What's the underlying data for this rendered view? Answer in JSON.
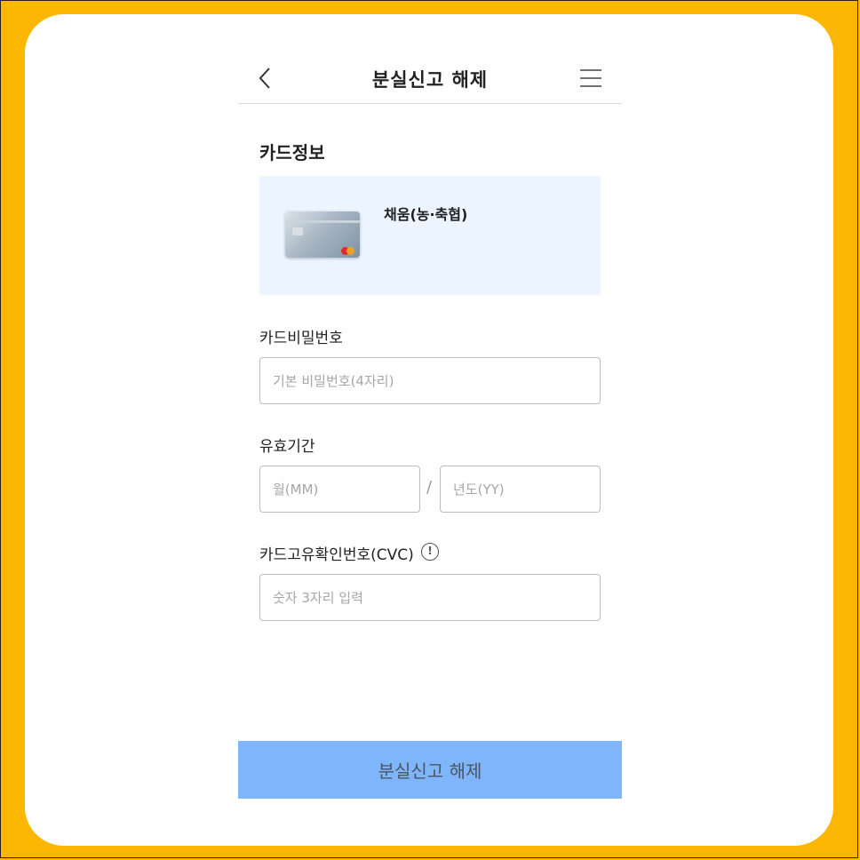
{
  "header": {
    "title": "분실신고 해제",
    "back_icon": "chevron-left-icon",
    "menu_icon": "hamburger-menu-icon"
  },
  "card_info": {
    "section_title": "카드정보",
    "card_name": "채움(농·축협)"
  },
  "password": {
    "label": "카드비밀번호",
    "placeholder": "기본 비밀번호(4자리)",
    "value": ""
  },
  "expiry": {
    "label": "유효기간",
    "month_placeholder": "월(MM)",
    "year_placeholder": "년도(YY)",
    "separator": "/"
  },
  "cvc": {
    "label": "카드고유확인번호(CVC)",
    "info_icon_text": "!",
    "placeholder": "숫자 3자리 입력"
  },
  "submit_label": "분실신고 해제",
  "colors": {
    "background": "#fbb701",
    "card_box": "#ecf4ff",
    "submit_button": "#7fb5fb"
  }
}
